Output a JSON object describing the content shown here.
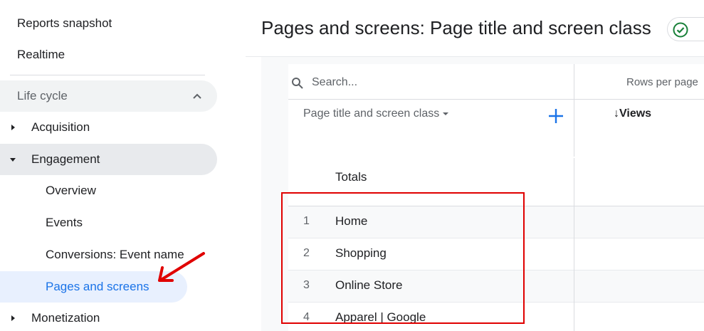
{
  "sidebar": {
    "top_items": [
      "Reports snapshot",
      "Realtime"
    ],
    "section_label": "Life cycle",
    "groups": [
      {
        "label": "Acquisition",
        "expanded": false
      },
      {
        "label": "Engagement",
        "expanded": true
      },
      {
        "label": "Monetization",
        "expanded": false
      }
    ],
    "engagement_items": [
      "Overview",
      "Events",
      "Conversions: Event name",
      "Pages and screens"
    ]
  },
  "header": {
    "title": "Pages and screens: Page title and screen class"
  },
  "table": {
    "search_placeholder": "Search...",
    "rows_per_page_label": "Rows per page",
    "dimension_header": "Page title and screen class",
    "metric_header": "Views",
    "totals_label": "Totals",
    "rows": [
      {
        "num": "1",
        "title": "Home"
      },
      {
        "num": "2",
        "title": "Shopping"
      },
      {
        "num": "3",
        "title": "Online Store"
      },
      {
        "num": "4",
        "title": "Apparel | Google"
      }
    ]
  },
  "colors": {
    "accent": "#1a73e8",
    "annotation": "#e00000",
    "check": "#188038"
  }
}
